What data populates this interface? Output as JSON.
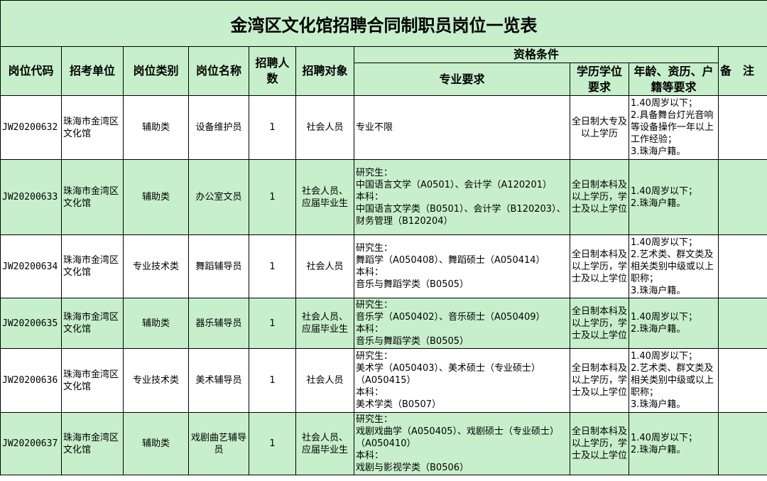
{
  "title": "金湾区文化馆招聘合同制职员岗位一览表",
  "headers": {
    "code": "岗位代码",
    "unit": "招考单位",
    "category": "岗位类别",
    "name": "岗位名称",
    "count": "招聘人数",
    "target": "招聘对象",
    "qualification": "资格条件",
    "major": "专业要求",
    "education": "学历学位要求",
    "other": "年龄、资历、户籍等要求",
    "remark": "备　注"
  },
  "rows": [
    {
      "code": "JW20200632",
      "unit": "珠海市金湾区文化馆",
      "category": "辅助类",
      "name": "设备维护员",
      "count": "1",
      "target": "社会人员",
      "major": "专业不限",
      "education": "全日制大专及以上学历",
      "other": "1.40周岁以下；\n2.具备舞台灯光音响等设备操作一年以上工作经验；\n3.珠海户籍。",
      "remark": ""
    },
    {
      "code": "JW20200633",
      "unit": "珠海市金湾区文化馆",
      "category": "辅助类",
      "name": "办公室文员",
      "count": "1",
      "target": "社会人员、应届毕业生",
      "major": "研究生：\n中国语言文学（A0501）、会计学（A120201）\n本科：\n中国语言文学类（B0501）、会计学（B120203）、财务管理（B120204）",
      "education": "全日制本科及以上学历，学士及以上学位",
      "other": "1.40周岁以下；\n2.珠海户籍。",
      "remark": ""
    },
    {
      "code": "JW20200634",
      "unit": "珠海市金湾区文化馆",
      "category": "专业技术类",
      "name": "舞蹈辅导员",
      "count": "1",
      "target": "社会人员",
      "major": "研究生：\n舞蹈学（A050408）、舞蹈硕士（A050414）\n本科：\n音乐与舞蹈学类（B0505）",
      "education": "全日制本科及以上学历，学士及以上学位",
      "other": "1.40周岁以下；\n2.艺术类、群文类及相关类别中级或以上职称；\n3.珠海户籍。",
      "remark": ""
    },
    {
      "code": "JW20200635",
      "unit": "珠海市金湾区文化馆",
      "category": "辅助类",
      "name": "器乐辅导员",
      "count": "1",
      "target": "社会人员、应届毕业生",
      "major": "研究生：\n音乐学（A050402）、音乐硕士（A050409）\n本科：\n音乐与舞蹈学类（B0505）",
      "education": "全日制本科及以上学历，学士及以上学位",
      "other": "1.40周岁以下；\n2.珠海户籍。",
      "remark": ""
    },
    {
      "code": "JW20200636",
      "unit": "珠海市金湾区文化馆",
      "category": "专业技术类",
      "name": "美术辅导员",
      "count": "1",
      "target": "社会人员",
      "major": "研究生：\n美术学（A050403）、美术硕士（专业硕士）（A050415）\n本科：\n美术学类（B0507）",
      "education": "全日制本科及以上学历，学士及以上学位",
      "other": "1.40周岁以下；\n2.艺术类、群文类及相关类别中级或以上职称；\n3.珠海户籍。",
      "remark": ""
    },
    {
      "code": "JW20200637",
      "unit": "珠海市金湾区文化馆",
      "category": "辅助类",
      "name": "戏剧曲艺辅导员",
      "count": "1",
      "target": "社会人员、应届毕业生",
      "major": "研究生：\n戏剧戏曲学（A050405）、戏剧硕士（专业硕士）（A050410）\n本科：\n戏剧与影视学类（B0506）",
      "education": "全日制本科及以上学历，学士及以上学位",
      "other": "1.40周岁以下；\n2.珠海户籍。",
      "remark": ""
    }
  ]
}
